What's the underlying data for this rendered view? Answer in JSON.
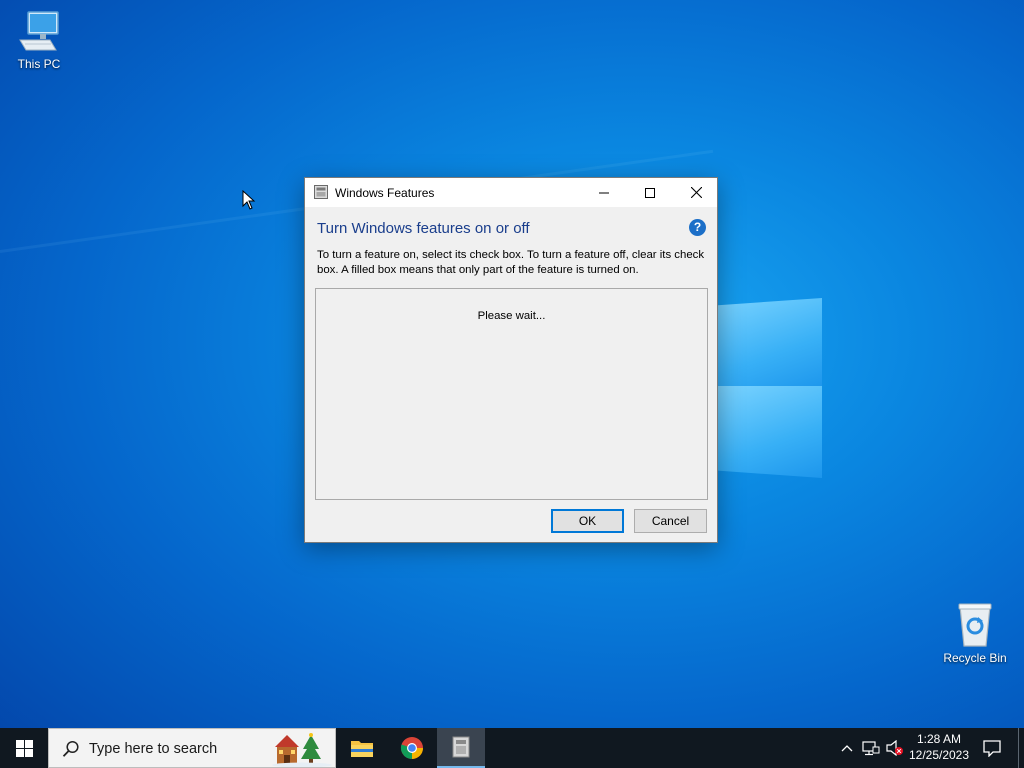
{
  "desktop": {
    "icons": [
      {
        "label": "This PC",
        "icon": "computer-icon"
      },
      {
        "label": "Recycle Bin",
        "icon": "recycle-bin-icon"
      }
    ]
  },
  "dialog": {
    "title": "Windows Features",
    "heading": "Turn Windows features on or off",
    "description": "To turn a feature on, select its check box. To turn a feature off, clear its check box. A filled box means that only part of the feature is turned on.",
    "status": "Please wait...",
    "ok_label": "OK",
    "cancel_label": "Cancel",
    "help_glyph": "?"
  },
  "taskbar": {
    "search_placeholder": "Type here to search",
    "apps": [
      {
        "name": "File Explorer",
        "icon": "folder-icon"
      },
      {
        "name": "Google Chrome",
        "icon": "chrome-icon"
      },
      {
        "name": "Windows Features",
        "icon": "windows-features-icon",
        "active": true
      }
    ],
    "clock": {
      "time": "1:28 AM",
      "date": "12/25/2023"
    }
  },
  "colors": {
    "accent": "#0078d7",
    "heading": "#1a3e8c",
    "taskbar": "#101820"
  }
}
